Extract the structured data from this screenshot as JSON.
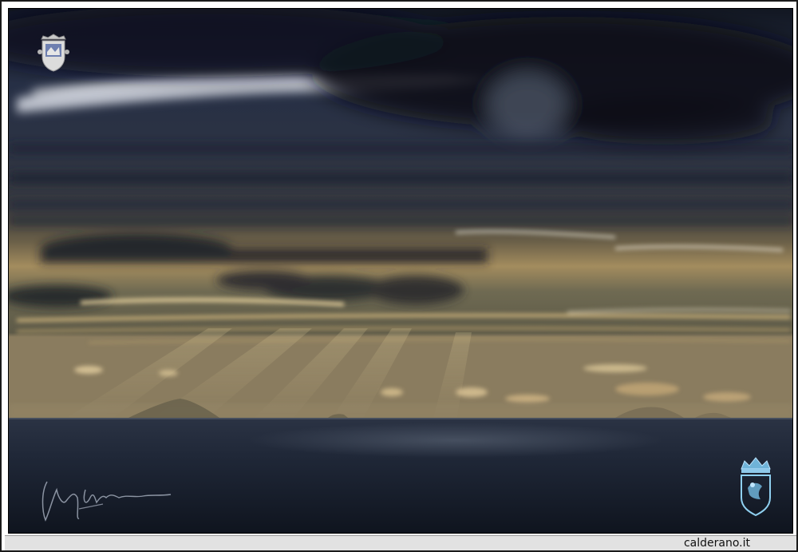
{
  "photo": {
    "subject": "seascape-sunrays-under-storm-clouds",
    "colors": {
      "sky_top": "#20283a",
      "cloud_dark": "#161b27",
      "glow_gold": "#e8c888",
      "sea": "#1c2433",
      "island": "#7a6f55"
    }
  },
  "watermarks": {
    "top_crest": "crest-icon",
    "bottom_crest": "crowned-shield-icon",
    "signature": "handwritten-signature"
  },
  "footer": {
    "site": "calderano.it"
  }
}
